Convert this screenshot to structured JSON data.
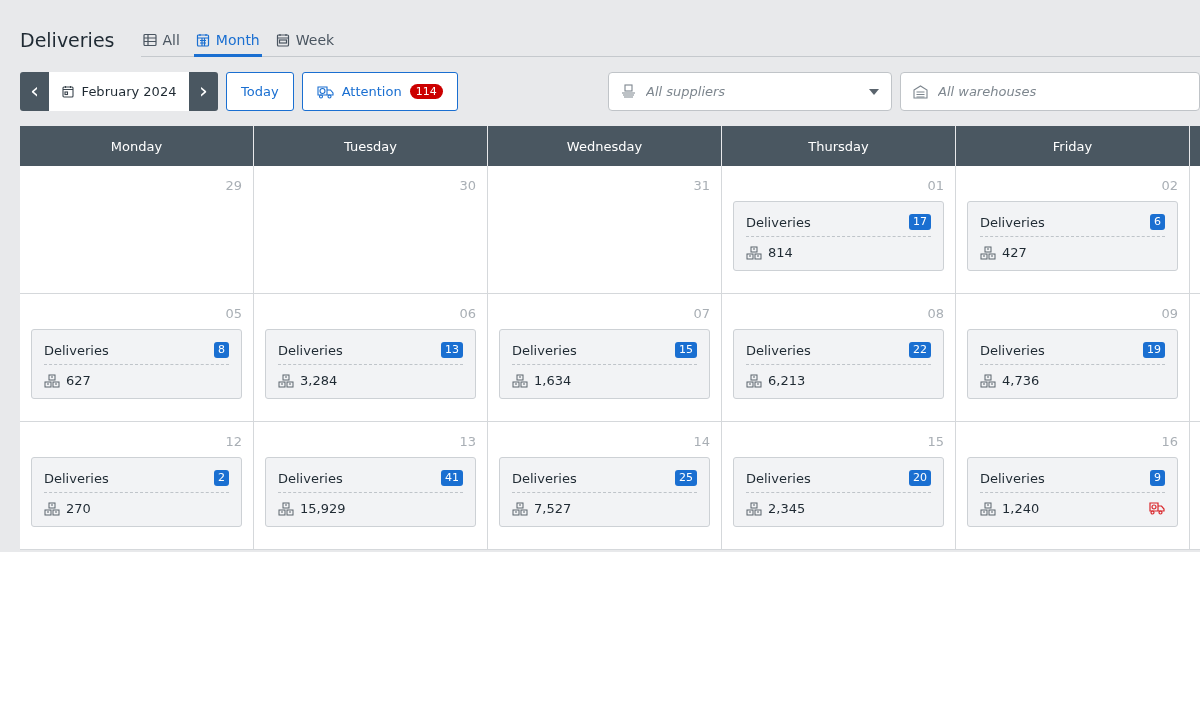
{
  "page_title": "Deliveries",
  "tabs": [
    {
      "label": "All",
      "kind": "table",
      "selected": false
    },
    {
      "label": "Month",
      "kind": "calendar",
      "selected": true
    },
    {
      "label": "Week",
      "kind": "week",
      "selected": false
    }
  ],
  "toolbar": {
    "prev": "‹",
    "period": "February 2024",
    "next": "›",
    "today": "Today",
    "attention": {
      "label": "Attention",
      "count": "114"
    }
  },
  "filters": [
    {
      "kind": "suppliers",
      "placeholder": "All suppliers",
      "caret": true
    },
    {
      "kind": "warehouses",
      "placeholder": "All warehouses",
      "caret": false
    }
  ],
  "weekdays": [
    "Monday",
    "Tuesday",
    "Wednesday",
    "Thursday",
    "Friday"
  ],
  "weeks": [
    {
      "days": [
        {
          "day": "29"
        },
        {
          "day": "30"
        },
        {
          "day": "31"
        },
        {
          "day": "01",
          "card": {
            "title": "Deliveries",
            "count": "17",
            "quantity": "814",
            "alert": false
          }
        },
        {
          "day": "02",
          "card": {
            "title": "Deliveries",
            "count": "6",
            "quantity": "427",
            "alert": false
          }
        }
      ]
    },
    {
      "days": [
        {
          "day": "05",
          "card": {
            "title": "Deliveries",
            "count": "8",
            "quantity": "627",
            "alert": false
          }
        },
        {
          "day": "06",
          "card": {
            "title": "Deliveries",
            "count": "13",
            "quantity": "3,284",
            "alert": false
          }
        },
        {
          "day": "07",
          "card": {
            "title": "Deliveries",
            "count": "15",
            "quantity": "1,634",
            "alert": false
          }
        },
        {
          "day": "08",
          "card": {
            "title": "Deliveries",
            "count": "22",
            "quantity": "6,213",
            "alert": false
          }
        },
        {
          "day": "09",
          "card": {
            "title": "Deliveries",
            "count": "19",
            "quantity": "4,736",
            "alert": false
          }
        }
      ]
    },
    {
      "days": [
        {
          "day": "12",
          "card": {
            "title": "Deliveries",
            "count": "2",
            "quantity": "270",
            "alert": false
          }
        },
        {
          "day": "13",
          "card": {
            "title": "Deliveries",
            "count": "41",
            "quantity": "15,929",
            "alert": false
          }
        },
        {
          "day": "14",
          "card": {
            "title": "Deliveries",
            "count": "25",
            "quantity": "7,527",
            "alert": false
          }
        },
        {
          "day": "15",
          "card": {
            "title": "Deliveries",
            "count": "20",
            "quantity": "2,345",
            "alert": false
          }
        },
        {
          "day": "16",
          "card": {
            "title": "Deliveries",
            "count": "9",
            "quantity": "1,240",
            "alert": true
          }
        }
      ]
    }
  ]
}
